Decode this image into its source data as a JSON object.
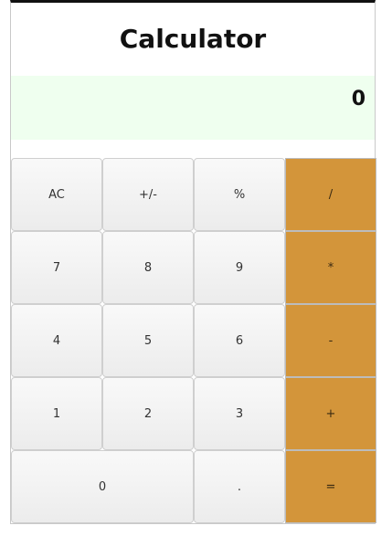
{
  "app": {
    "title": "Calculator"
  },
  "display": {
    "value": "0"
  },
  "keys": {
    "ac": "AC",
    "sign": "+/-",
    "percent": "%",
    "divide": "/",
    "seven": "7",
    "eight": "8",
    "nine": "9",
    "multiply": "*",
    "four": "4",
    "five": "5",
    "six": "6",
    "subtract": "-",
    "one": "1",
    "two": "2",
    "three": "3",
    "add": "+",
    "zero": "0",
    "decimal": ".",
    "equals": "="
  },
  "colors": {
    "operator_bg": "#d3953a",
    "display_bg": "#efffef",
    "key_bg": "#f2f2f2"
  }
}
